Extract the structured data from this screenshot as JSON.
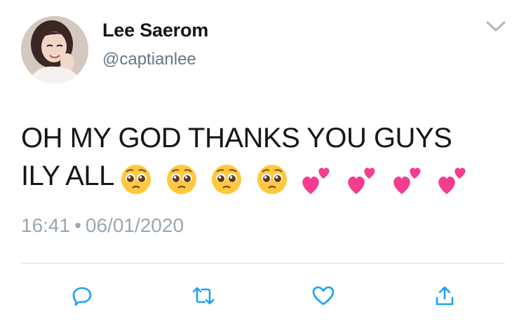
{
  "user": {
    "display_name": "Lee Saerom",
    "handle": "@captianlee"
  },
  "tweet": {
    "line1": "OH MY GOD THANKS YOU GUYS",
    "line2": "ILY ALL",
    "emojis": [
      "pleading-face",
      "pleading-face",
      "pleading-face",
      "pleading-face",
      "two-hearts",
      "two-hearts",
      "two-hearts",
      "two-hearts"
    ],
    "time": "16:41",
    "separator": "•",
    "date": "06/01/2020"
  },
  "actions": {
    "reply_icon": "reply-icon",
    "retweet_icon": "retweet-icon",
    "like_icon": "heart-icon",
    "share_icon": "share-icon"
  },
  "colors": {
    "action_blue": "#1da1f2",
    "secondary_gray": "#657786",
    "divider": "#d6dbe0",
    "heart_pink": "#f43d8e"
  }
}
